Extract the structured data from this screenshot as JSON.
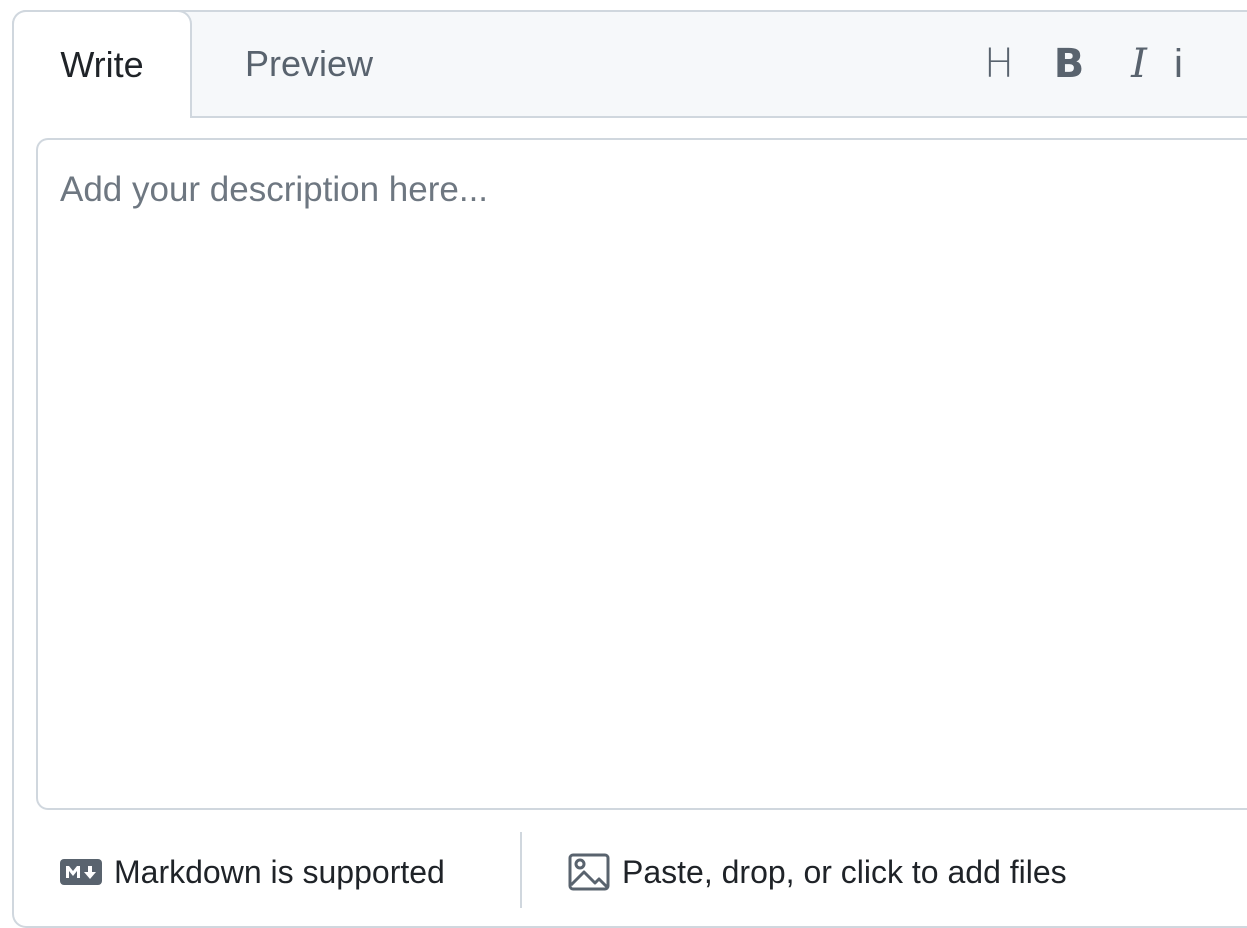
{
  "tabs": {
    "write": "Write",
    "preview": "Preview"
  },
  "toolbar": {
    "heading": "H",
    "bold": "B",
    "italic": "I",
    "partial": "i"
  },
  "textarea": {
    "placeholder": "Add your description here..."
  },
  "footer": {
    "markdown": "Markdown is supported",
    "files": "Paste, drop, or click to add files"
  },
  "colors": {
    "border": "#d0d7de",
    "header_bg": "#f6f8fa",
    "muted_text": "#59636e",
    "text": "#1f2328"
  }
}
